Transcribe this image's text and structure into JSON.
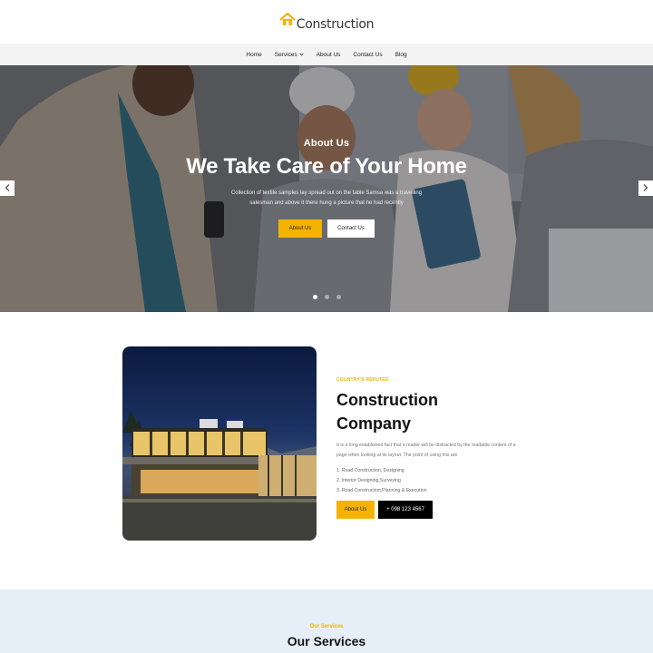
{
  "header": {
    "logo_text": "Construction",
    "logo_icon": "house-icon",
    "brand_color": "#f5b301"
  },
  "nav": {
    "items": [
      {
        "label": "Home"
      },
      {
        "label": "Services",
        "dropdown": true
      },
      {
        "label": "About Us"
      },
      {
        "label": "Contact Us"
      },
      {
        "label": "Blog"
      }
    ]
  },
  "hero": {
    "eyebrow": "About Us",
    "title": "We Take Care of Your Home",
    "description": "Collection of textile samples lay spread out on the table Samsa was a travelling salesman and above it there hung a picture that he had recently",
    "primary_button": "About Us",
    "secondary_button": "Contact Us",
    "prev_icon": "chevron-left-icon",
    "next_icon": "chevron-right-icon",
    "slides": 3,
    "active_slide": 1
  },
  "about": {
    "eyebrow": "COUNTRY'S REPUTED",
    "title_line1": "Construction",
    "title_line2": "Company",
    "description": "It is a long established fact that a reader will be distracted by the readable content of a page when looking at its layout. The point of using this are",
    "list": [
      "1. Road Construction, Designing",
      "2. Interior Designing,Surveying",
      "3. Road Construction,Planning & Execution"
    ],
    "primary_button": "About Us",
    "phone_button": "+ 098 123 4567"
  },
  "services": {
    "eyebrow": "Our Services",
    "title": "Our Services"
  }
}
